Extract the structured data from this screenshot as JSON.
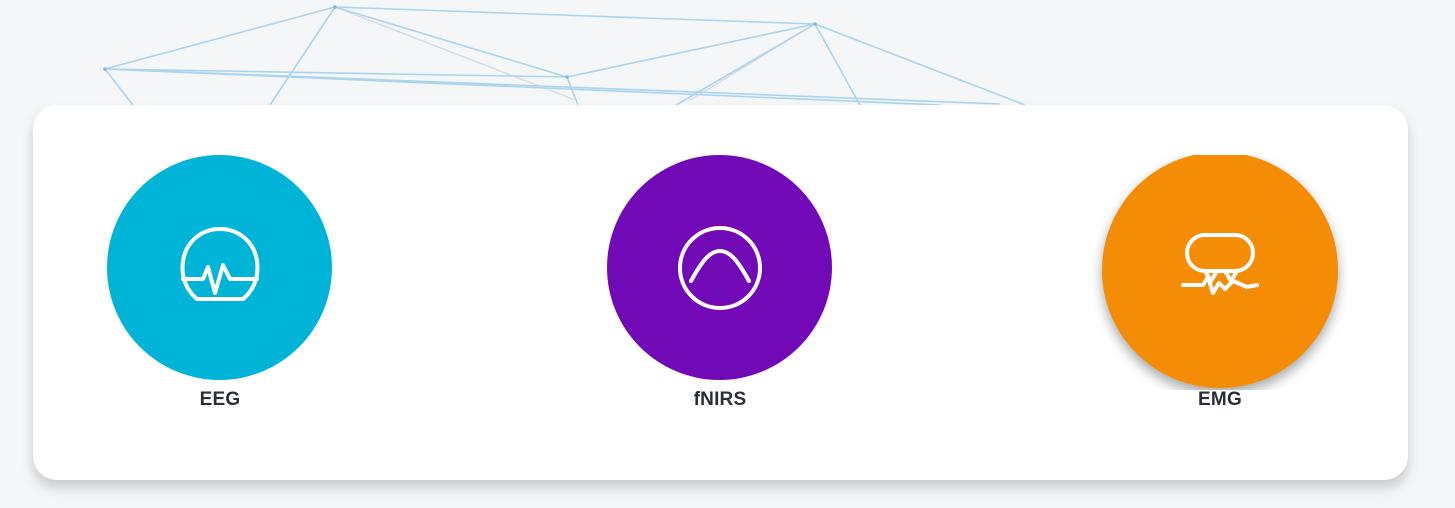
{
  "page": {
    "background_color": "#f4f6f8"
  },
  "card": {
    "background_color": "#ffffff"
  },
  "modalities": [
    {
      "id": "eeg",
      "label": "EEG",
      "color": "#00b4d8",
      "icon": "eeg-head-waveform-icon"
    },
    {
      "id": "fnirs",
      "label": "fNIRS",
      "color": "#7209b7",
      "icon": "fnirs-curve-circle-icon"
    },
    {
      "id": "emg",
      "label": "EMG",
      "color": "#f48c06",
      "icon": "emg-muscle-signal-icon"
    }
  ]
}
